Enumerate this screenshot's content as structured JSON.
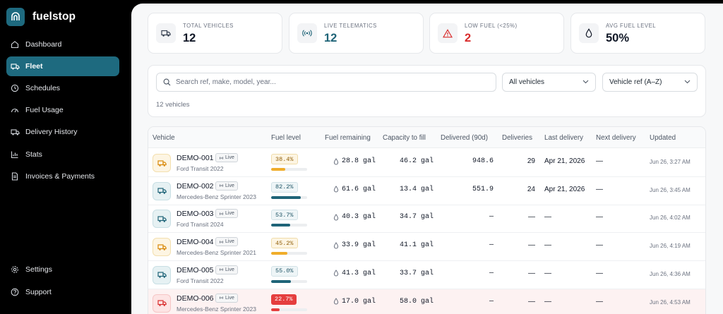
{
  "app": {
    "name": "fuelstop"
  },
  "colors": {
    "teal": "#1e6a7f",
    "amber": "#f0ad2a",
    "red": "#e53e3e",
    "tealBar": "#1f6478"
  },
  "nav": {
    "items": [
      {
        "label": "Dashboard",
        "icon": "home-icon"
      },
      {
        "label": "Fleet",
        "icon": "truck-icon",
        "active": true
      },
      {
        "label": "Schedules",
        "icon": "clock-icon"
      },
      {
        "label": "Fuel Usage",
        "icon": "gauge-icon"
      },
      {
        "label": "Delivery History",
        "icon": "truck-icon"
      },
      {
        "label": "Stats",
        "icon": "bar-chart-icon"
      },
      {
        "label": "Invoices & Payments",
        "icon": "document-icon"
      }
    ],
    "bottom": [
      {
        "label": "Settings",
        "icon": "gear-icon"
      },
      {
        "label": "Support",
        "icon": "help-icon"
      }
    ]
  },
  "stats": [
    {
      "label": "Total vehicles",
      "value": "12",
      "icon": "truck-icon"
    },
    {
      "label": "Live telematics",
      "value": "12",
      "icon": "broadcast-icon"
    },
    {
      "label": "Low fuel (<25%)",
      "value": "2",
      "icon": "warning-icon"
    },
    {
      "label": "Avg fuel level",
      "value": "50%",
      "icon": "droplet-icon"
    }
  ],
  "filters": {
    "search_placeholder": "Search ref, make, model, year...",
    "vehicle_filter": "All vehicles",
    "sort": "Vehicle ref (A–Z)",
    "count": "12 vehicles"
  },
  "table": {
    "headers": [
      "Vehicle",
      "Fuel level",
      "Fuel remaining",
      "Capacity to fill",
      "Delivered (90d)",
      "Deliveries",
      "Last delivery",
      "Next delivery",
      "Updated"
    ],
    "rows": [
      {
        "ref": "DEMO-001",
        "live": "Live",
        "model": "Ford Transit 2022",
        "fuel_pct": "38.4%",
        "fuel_level": 0.384,
        "status": "amber",
        "remaining": "28.8 gal",
        "capacity": "46.2 gal",
        "delivered": "948.6",
        "deliveries": "29",
        "last": "Apr 21, 2026",
        "next": "—",
        "updated": "Jun 26, 3:27 AM"
      },
      {
        "ref": "DEMO-002",
        "live": "Live",
        "model": "Mercedes-Benz Sprinter 2023",
        "fuel_pct": "82.2%",
        "fuel_level": 0.822,
        "status": "teal",
        "remaining": "61.6 gal",
        "capacity": "13.4 gal",
        "delivered": "551.9",
        "deliveries": "24",
        "last": "Apr 21, 2026",
        "next": "—",
        "updated": "Jun 26, 3:45 AM"
      },
      {
        "ref": "DEMO-003",
        "live": "Live",
        "model": "Ford Transit 2024",
        "fuel_pct": "53.7%",
        "fuel_level": 0.537,
        "status": "teal",
        "remaining": "40.3 gal",
        "capacity": "34.7 gal",
        "delivered": "—",
        "deliveries": "—",
        "last": "—",
        "next": "—",
        "updated": "Jun 26, 4:02 AM"
      },
      {
        "ref": "DEMO-004",
        "live": "Live",
        "model": "Mercedes-Benz Sprinter 2021",
        "fuel_pct": "45.2%",
        "fuel_level": 0.452,
        "status": "amber",
        "remaining": "33.9 gal",
        "capacity": "41.1 gal",
        "delivered": "—",
        "deliveries": "—",
        "last": "—",
        "next": "—",
        "updated": "Jun 26, 4:19 AM"
      },
      {
        "ref": "DEMO-005",
        "live": "Live",
        "model": "Ford Transit 2022",
        "fuel_pct": "55.0%",
        "fuel_level": 0.55,
        "status": "teal",
        "remaining": "41.3 gal",
        "capacity": "33.7 gal",
        "delivered": "—",
        "deliveries": "—",
        "last": "—",
        "next": "—",
        "updated": "Jun 26, 4:36 AM"
      },
      {
        "ref": "DEMO-006",
        "live": "Live",
        "model": "Mercedes-Benz Sprinter 2023",
        "fuel_pct": "22.7%",
        "fuel_level": 0.227,
        "status": "red",
        "remaining": "17.0 gal",
        "capacity": "58.0 gal",
        "delivered": "—",
        "deliveries": "—",
        "last": "—",
        "next": "—",
        "updated": "Jun 26, 4:53 AM"
      }
    ]
  }
}
